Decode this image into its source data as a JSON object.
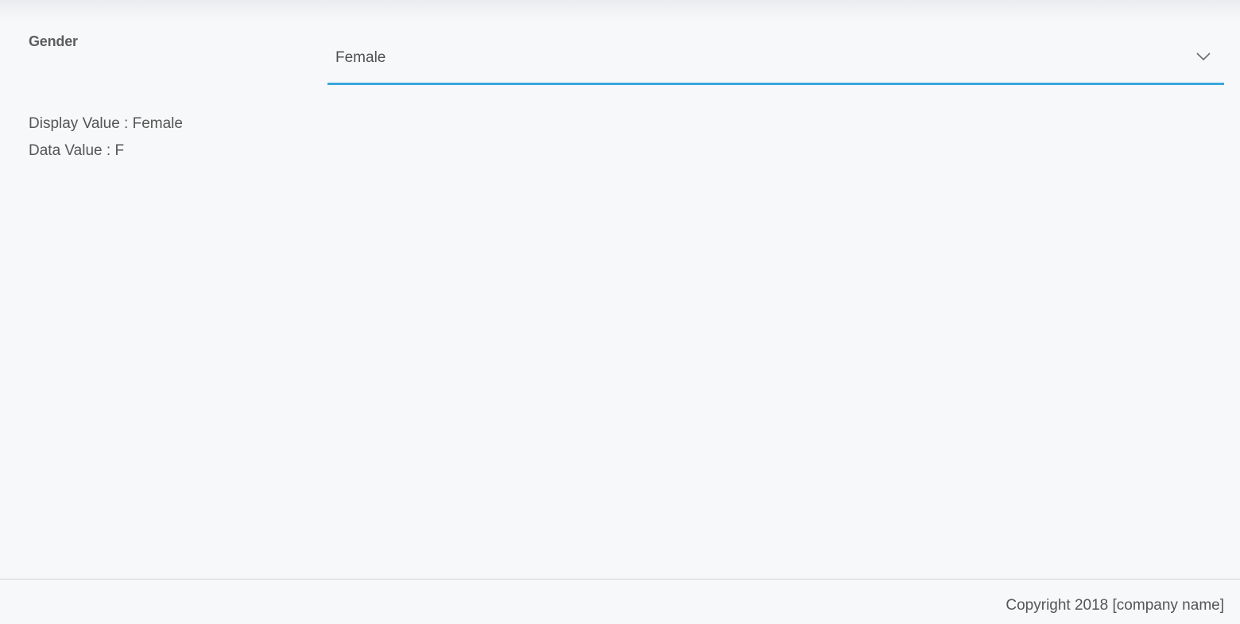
{
  "form": {
    "gender_label": "Gender",
    "gender_select": {
      "selected_value": "Female",
      "icon": "chevron-down-icon"
    }
  },
  "output": {
    "display_prefix": "Display Value : ",
    "display_value": "Female",
    "data_prefix": "Data Value : ",
    "data_value": "F"
  },
  "footer": {
    "copyright": "Copyright 2018 [company name]"
  },
  "colors": {
    "background": "#f6f8fa",
    "accent_underline": "#3aa7db",
    "text": "#555555"
  }
}
